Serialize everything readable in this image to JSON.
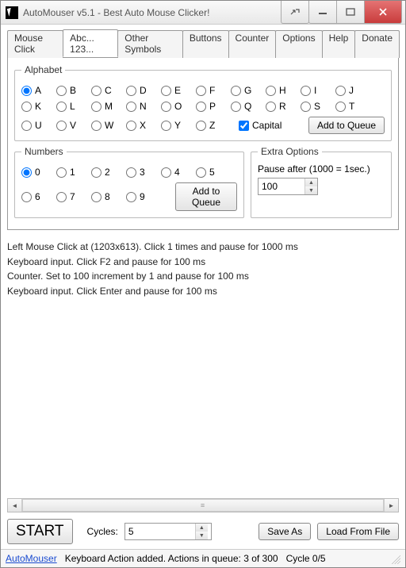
{
  "window": {
    "title": "AutoMouser v5.1 - Best Auto Mouse Clicker!"
  },
  "tabs": [
    "Mouse Click",
    "Abc... 123...",
    "Other Symbols",
    "Buttons",
    "Counter",
    "Options",
    "Help",
    "Donate"
  ],
  "active_tab": 1,
  "alphabet": {
    "legend": "Alphabet",
    "letters": [
      "A",
      "B",
      "C",
      "D",
      "E",
      "F",
      "G",
      "H",
      "I",
      "J",
      "K",
      "L",
      "M",
      "N",
      "O",
      "P",
      "Q",
      "R",
      "S",
      "T",
      "U",
      "V",
      "W",
      "X",
      "Y",
      "Z"
    ],
    "selected": "A",
    "capital_label": "Capital",
    "capital_checked": true,
    "add_button": "Add to Queue"
  },
  "numbers": {
    "legend": "Numbers",
    "digits": [
      "0",
      "1",
      "2",
      "3",
      "4",
      "5",
      "6",
      "7",
      "8",
      "9"
    ],
    "selected": "0",
    "add_button": "Add to Queue"
  },
  "extra": {
    "legend": "Extra Options",
    "pause_label": "Pause after (1000 = 1sec.)",
    "pause_value": "100"
  },
  "log": [
    "Left Mouse Click at  (1203x613). Click 1 times and pause for 1000 ms",
    "Keyboard input. Click F2 and pause for 100 ms",
    "Counter. Set to 100 increment by 1 and pause for 100 ms",
    "Keyboard input. Click Enter and pause for 100 ms"
  ],
  "actions": {
    "start": "START",
    "cycles_label": "Cycles:",
    "cycles_value": "5",
    "save_as": "Save As",
    "load_from_file": "Load From File"
  },
  "status": {
    "link": "AutoMouser",
    "message": "Keyboard Action added. Actions in queue: 3 of 300",
    "cycle": "Cycle 0/5"
  }
}
